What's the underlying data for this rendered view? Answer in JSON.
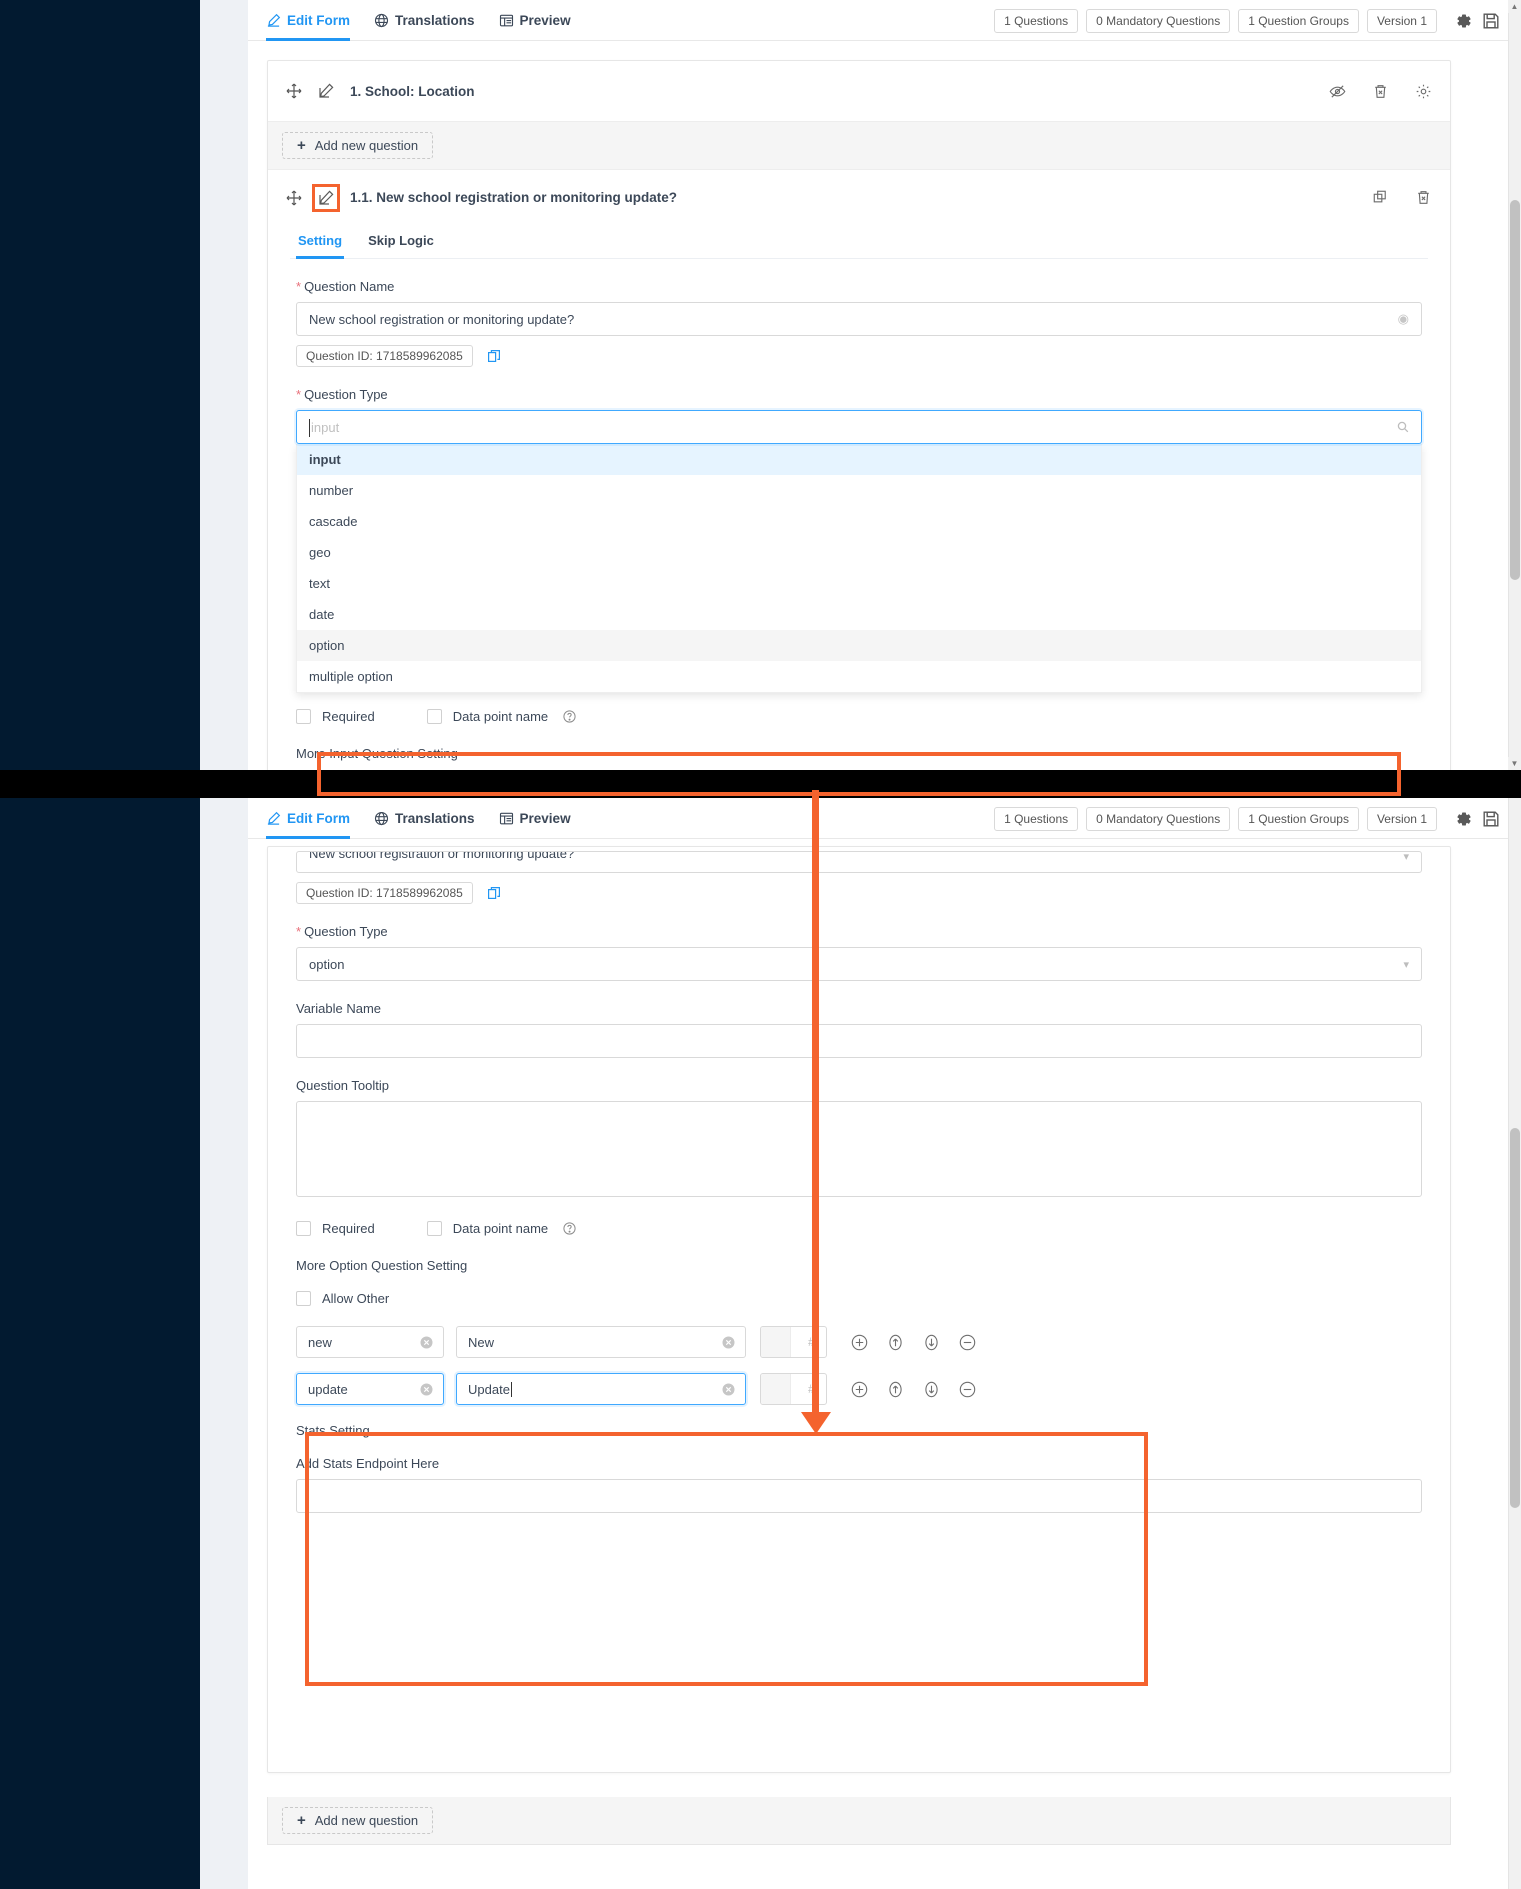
{
  "toolbar": {
    "tabs": [
      {
        "label": "Edit Form",
        "icon": "edit-icon",
        "active": true
      },
      {
        "label": "Translations",
        "icon": "globe-icon",
        "active": false
      },
      {
        "label": "Preview",
        "icon": "preview-icon",
        "active": false
      }
    ],
    "chips": [
      {
        "label": "1 Questions"
      },
      {
        "label": "0 Mandatory Questions"
      },
      {
        "label": "1 Question Groups"
      },
      {
        "label": "Version 1"
      }
    ],
    "icons": [
      {
        "name": "settings-gear-icon"
      },
      {
        "name": "save-disk-icon"
      }
    ]
  },
  "top_panel": {
    "group": {
      "title": "1. School: Location",
      "actions": [
        "hide-eye-icon",
        "delete-icon",
        "settings-gear-icon"
      ]
    },
    "add_question_label": "Add new question",
    "question": {
      "title": "1.1. New school registration or monitoring update?",
      "actions": [
        "duplicate-icon",
        "delete-icon"
      ],
      "subtabs": [
        {
          "label": "Setting",
          "active": true
        },
        {
          "label": "Skip Logic",
          "active": false
        }
      ],
      "question_name_label": "Question Name",
      "question_name_value": "New school registration or monitoring update?",
      "question_id_chip": "Question ID: 1718589962085",
      "question_type_label": "Question Type",
      "question_type_search_placeholder": "input",
      "dropdown_options": [
        "input",
        "number",
        "cascade",
        "geo",
        "text",
        "date",
        "option",
        "multiple option"
      ],
      "dropdown_selected": "input",
      "dropdown_hovered": "option",
      "required_label": "Required",
      "data_point_name_label": "Data point name",
      "more_setting_label": "More Input Question Setting"
    }
  },
  "bottom_panel": {
    "question_name_value": "New school registration or monitoring update?",
    "question_id_chip": "Question ID: 1718589962085",
    "question_type_label": "Question Type",
    "question_type_value": "option",
    "variable_name_label": "Variable Name",
    "variable_name_value": "",
    "question_tooltip_label": "Question Tooltip",
    "question_tooltip_value": "",
    "required_label": "Required",
    "data_point_name_label": "Data point name",
    "more_setting_label": "More Option Question Setting",
    "allow_other_label": "Allow Other",
    "option_rows": [
      {
        "value": "new",
        "name": "New",
        "order": "",
        "order_placeholder": "#.",
        "focused": false
      },
      {
        "value": "update",
        "name": "Update",
        "order": "",
        "order_placeholder": "#.",
        "focused": true
      }
    ],
    "row_buttons": [
      "add-option-icon",
      "move-up-icon",
      "move-down-icon",
      "remove-option-icon"
    ],
    "stats_setting_label": "Stats Setting",
    "stats_endpoint_label": "Add Stats Endpoint Here",
    "stats_endpoint_value": "",
    "add_question_label": "Add new question"
  },
  "colors": {
    "accent_blue": "#2196f3",
    "highlight_orange": "#f4632e",
    "page_bg": "#021a30",
    "panel_bg": "#eef1f5"
  }
}
